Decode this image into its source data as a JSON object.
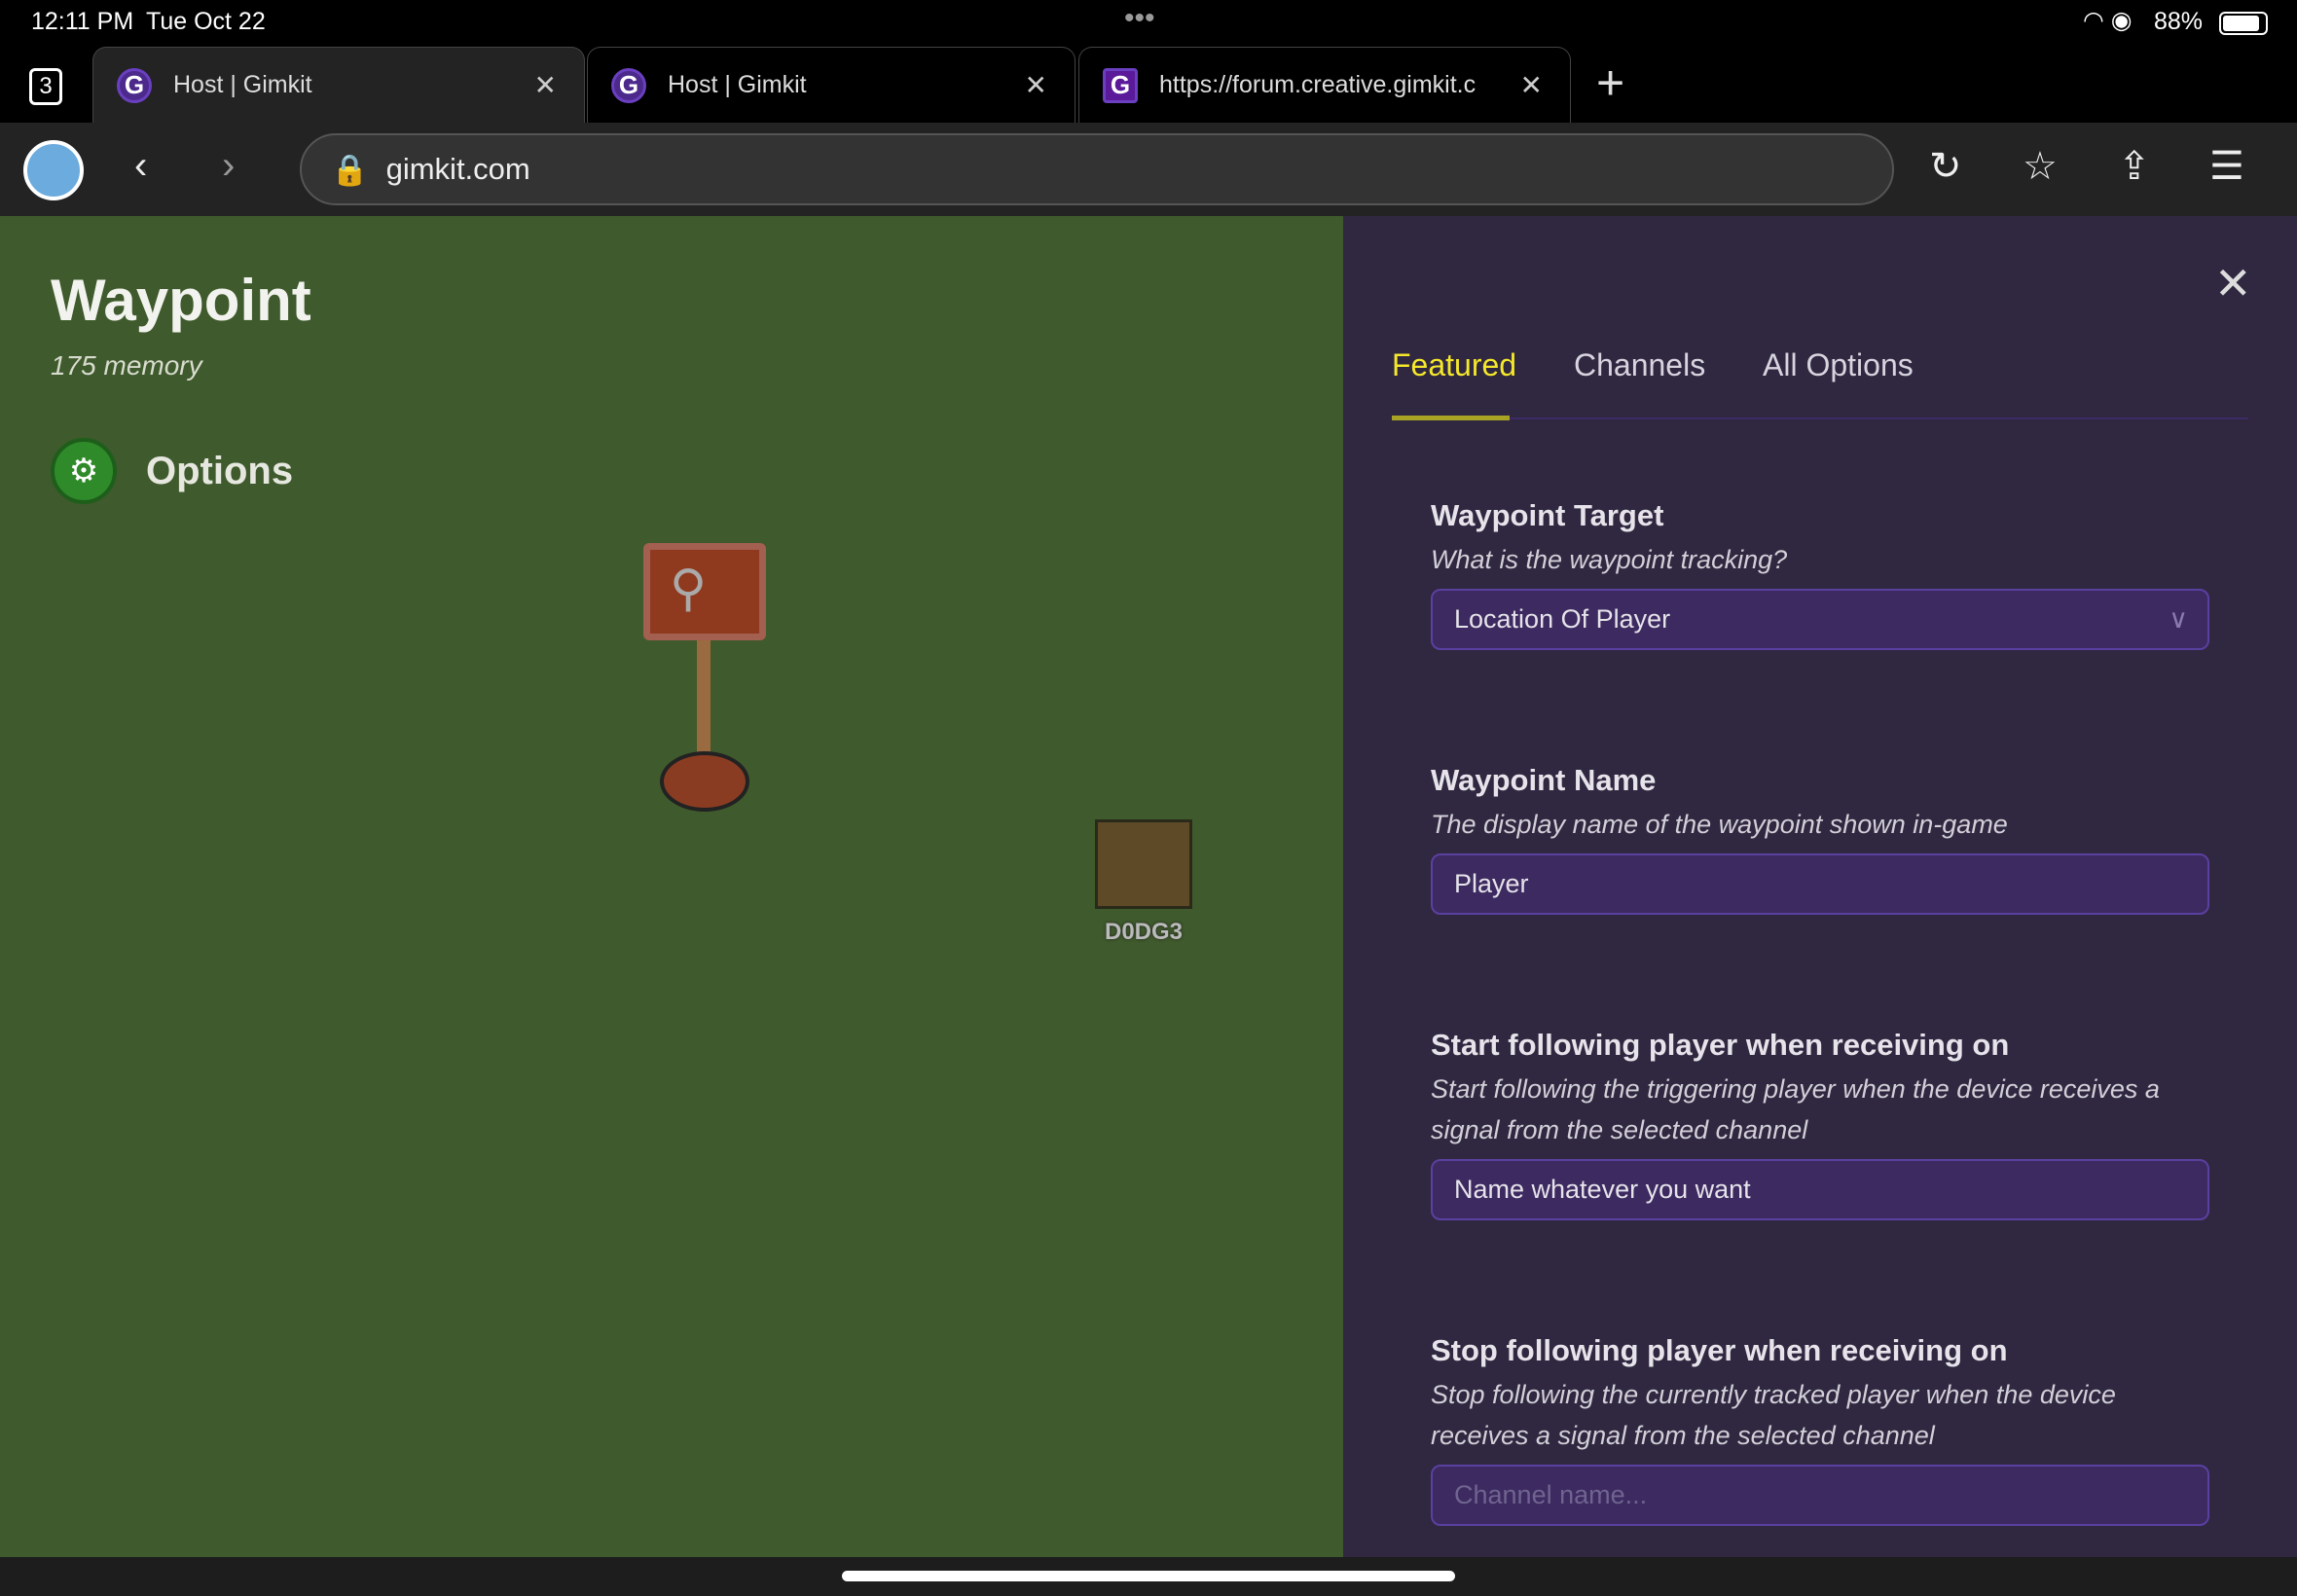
{
  "status": {
    "time": "12:11 PM",
    "date": "Tue Oct 22",
    "battery": "88%"
  },
  "tabs": {
    "count": "3",
    "items": [
      {
        "title": "Host | Gimkit",
        "active": true
      },
      {
        "title": "Host | Gimkit",
        "active": false
      },
      {
        "title": "https://forum.creative.gimkit.c",
        "active": false
      }
    ]
  },
  "address": {
    "url": "gimkit.com"
  },
  "game": {
    "title": "Waypoint",
    "memory": "175 memory",
    "options_label": "Options",
    "player_name": "D0DG3"
  },
  "panel": {
    "tabs": [
      {
        "label": "Featured",
        "active": true
      },
      {
        "label": "Channels"
      },
      {
        "label": "All Options"
      }
    ],
    "fields": [
      {
        "label": "Waypoint Target",
        "desc": "What is the waypoint tracking?",
        "value": "Location Of Player",
        "type": "select"
      },
      {
        "label": "Waypoint Name",
        "desc": "The display name of the waypoint shown in-game",
        "value": "Player"
      },
      {
        "label": "Start following player when receiving on",
        "desc": "Start following the triggering player when the device receives a signal from the selected channel",
        "value": "Name whatever you want"
      },
      {
        "label": "Stop following player when receiving on",
        "desc": "Stop following the currently tracked player when the device receives a signal from the selected channel",
        "placeholder": "Channel name..."
      }
    ]
  },
  "colors": {
    "accent": "#f5e82a",
    "panel_bg": "#2f2840",
    "grass": "#3f5a2c",
    "input_bg": "#3c2a60"
  }
}
